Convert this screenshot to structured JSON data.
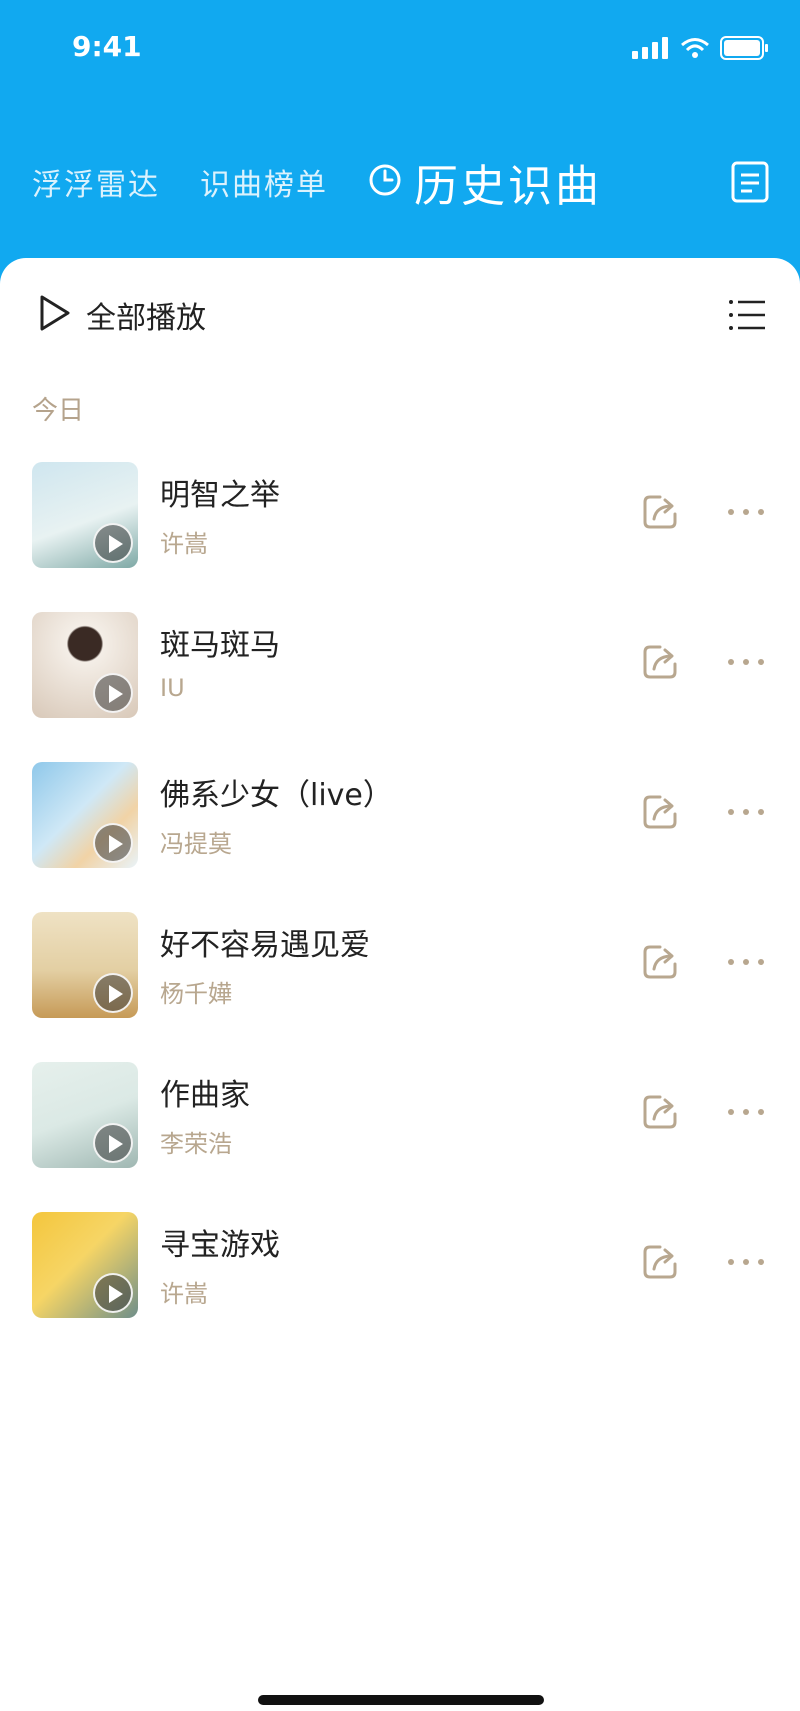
{
  "status_bar": {
    "time": "9:41",
    "icons": [
      "signal-icon",
      "wifi-icon",
      "battery-icon"
    ]
  },
  "header": {
    "tabs": [
      {
        "label": "浮浮雷达"
      },
      {
        "label": "识曲榜单"
      }
    ],
    "active_tab": {
      "label": "历史识曲",
      "icon": "clock-icon"
    },
    "right_icon": "document-icon",
    "bg_color": "#11a9f0"
  },
  "toolbar": {
    "play_all_label": "全部播放",
    "play_icon": "play-outline-icon",
    "list_icon": "list-icon"
  },
  "section_label": "今日",
  "songs": [
    {
      "title": "明智之举",
      "artist": "许嵩",
      "cover_colors": [
        "#cfe6ef",
        "#7fa9a6"
      ]
    },
    {
      "title": "斑马斑马",
      "artist": "IU",
      "cover_colors": [
        "#f4eee7",
        "#d8c8b8"
      ]
    },
    {
      "title": "佛系少女（live）",
      "artist": "冯提莫",
      "cover_colors": [
        "#8fc8ea",
        "#f1d3a6"
      ]
    },
    {
      "title": "好不容易遇见爱",
      "artist": "杨千嬅",
      "cover_colors": [
        "#efe2c4",
        "#c69a57"
      ]
    },
    {
      "title": "作曲家",
      "artist": "李荣浩",
      "cover_colors": [
        "#dbe9e5",
        "#9fb7b2"
      ]
    },
    {
      "title": "寻宝游戏",
      "artist": "许嵩",
      "cover_colors": [
        "#f4c63d",
        "#6f8f8a"
      ]
    }
  ],
  "row_icons": {
    "share": "share-icon",
    "more": "more-icon"
  },
  "accent_color": "#b8a78f"
}
